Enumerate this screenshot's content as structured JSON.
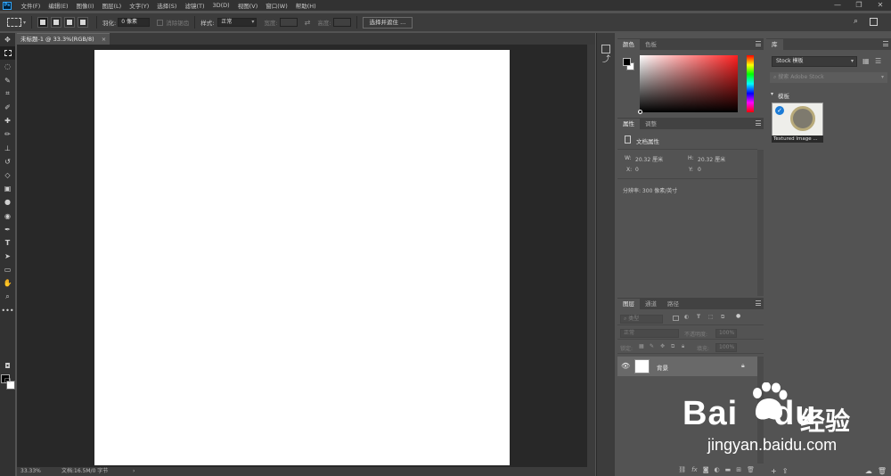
{
  "app": {
    "logo": "Ps"
  },
  "menubar": {
    "items": [
      "文件(F)",
      "编辑(E)",
      "图像(I)",
      "图层(L)",
      "文字(Y)",
      "选择(S)",
      "滤镜(T)",
      "3D(D)",
      "视图(V)",
      "窗口(W)",
      "帮助(H)"
    ],
    "window_controls": [
      "—",
      "❐",
      "✕"
    ]
  },
  "options": {
    "feather_label": "羽化:",
    "feather_value": "0 像素",
    "antialias_label": "消除锯齿",
    "style_label": "样式:",
    "style_value": "正常",
    "width_label": "宽度:",
    "height_label": "高度:",
    "select_mask_label": "选择并遮住 ..."
  },
  "document": {
    "tab_title": "未标题-1 @ 33.3%(RGB/8)",
    "tab_close": "×",
    "canvas_color": "#ffffff"
  },
  "status": {
    "zoom": "33.33%",
    "doc_info": "文档:16.5M/0 字节",
    "arrow": "›"
  },
  "color_panel": {
    "tabs": [
      "颜色",
      "色板"
    ],
    "foreground": "#000000",
    "background": "#ffffff",
    "hue": "#ff2020"
  },
  "properties_panel": {
    "tabs": [
      "属性",
      "调整"
    ],
    "section_title": "文档属性",
    "w_label": "W:",
    "w_value": "20.32  厘米",
    "h_label": "H:",
    "h_value": "20.32  厘米",
    "x_label": "X:",
    "x_value": "0",
    "y_label": "Y:",
    "y_value": "0",
    "resolution": "分辨率: 300 像素/英寸"
  },
  "layers_panel": {
    "tabs": [
      "图层",
      "通道",
      "路径"
    ],
    "filter_label": "类型",
    "blend_mode": "正常",
    "opacity_label": "不透明度:",
    "opacity_value": "100%",
    "lock_label": "锁定:",
    "fill_label": "填充:",
    "fill_value": "100%",
    "layers": [
      {
        "name": "背景",
        "visible": true,
        "locked": true
      }
    ],
    "footer_icons": [
      "link-icon",
      "fx-icon",
      "mask-icon",
      "adjustment-icon",
      "folder-icon",
      "new-layer-icon",
      "trash-icon"
    ]
  },
  "library_panel": {
    "tab": "库",
    "dropdown": "Stock 模板",
    "search_placeholder": "搜索 Adobe Stock",
    "section": "模板",
    "thumb_caption": "Textured Image ..."
  },
  "watermark": {
    "brand": "Bai",
    "brand2": "du",
    "cn": "经验",
    "url": "jingyan.baidu.com"
  }
}
